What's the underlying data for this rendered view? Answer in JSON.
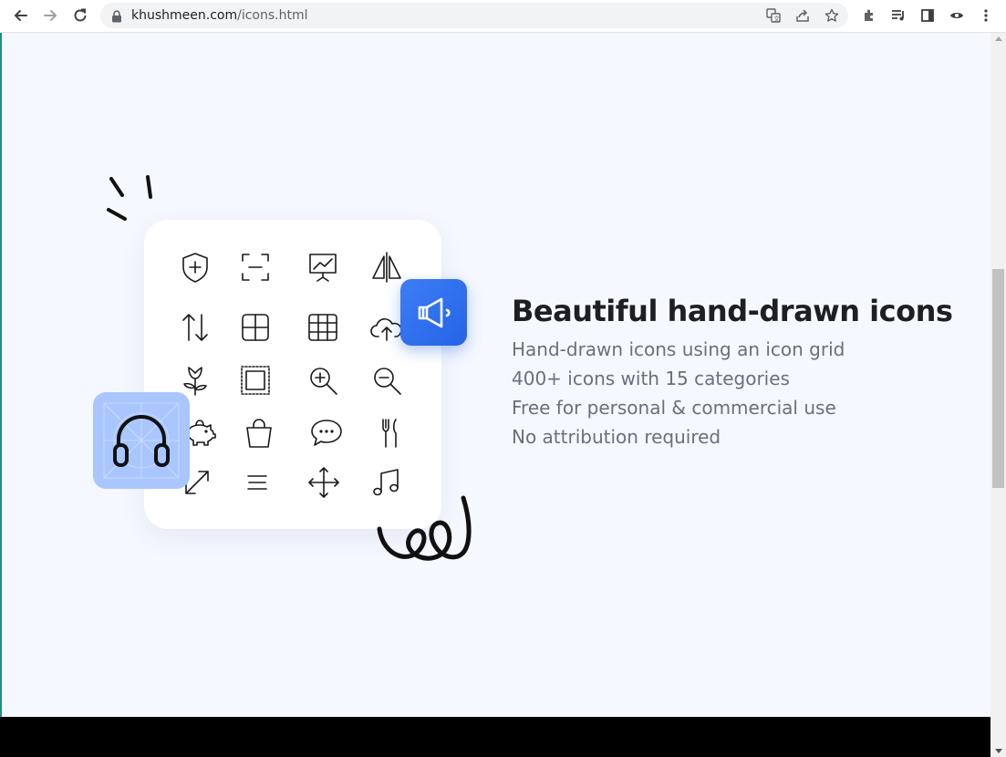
{
  "browser": {
    "url_domain": "khushmeen.com",
    "url_path": "/icons.html",
    "icons": [
      "back-icon",
      "forward-icon",
      "reload-icon",
      "lock-icon",
      "translate-icon",
      "share-icon",
      "bookmark-star-icon",
      "extensions-icon",
      "media-queue-icon",
      "side-panel-icon",
      "profile-icon",
      "menu-icon"
    ]
  },
  "hero": {
    "heading": "Beautiful hand-drawn icons",
    "features": [
      "Hand-drawn icons using an icon grid",
      "400+ icons with 15 categories",
      "Free for personal & commercial use",
      "No attribution required"
    ]
  },
  "icon_grid": [
    "shield-plus-icon",
    "scan-frame-icon",
    "presentation-chart-icon",
    "flip-horizontal-icon",
    "sort-arrows-icon",
    "grid-2x2-icon",
    "grid-3x3-icon",
    "cloud-upload-icon",
    "flower-icon",
    "stamp-frame-icon",
    "zoom-in-icon",
    "zoom-out-icon",
    "piggy-bank-icon",
    "shopping-bag-icon",
    "chat-bubble-icon",
    "cutlery-icon",
    "expand-diagonal-icon",
    "menu-lines-icon",
    "move-arrows-icon",
    "music-note-icon"
  ],
  "colors": {
    "page_bg": "#f6f8ff",
    "accent_blue": "#2563e6",
    "tile_light_blue": "#a9c6ff",
    "heading": "#1e1f24",
    "body_text": "#6b6f7a"
  }
}
